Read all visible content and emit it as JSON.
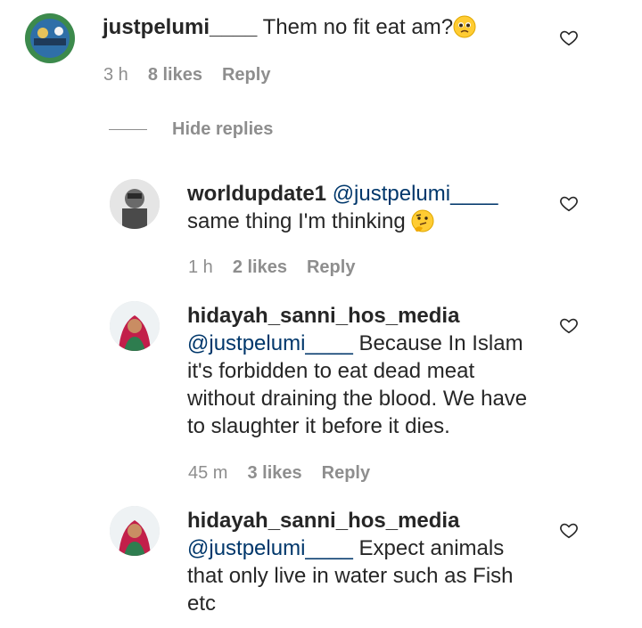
{
  "comments": [
    {
      "username": "justpelumi____",
      "mention": "",
      "text": "Them no fit eat am?",
      "time": "3 h",
      "likes": "8 likes",
      "reply": "Reply"
    },
    {
      "username": "worldupdate1",
      "mention": "@justpelumi____",
      "text": "same thing I'm thinking",
      "time": "1 h",
      "likes": "2 likes",
      "reply": "Reply"
    },
    {
      "username": "hidayah_sanni_hos_media",
      "mention": "@justpelumi____",
      "text_line1": "Because In Islam",
      "text_line2": "it's forbidden to eat dead meat",
      "text_line3": "without draining the blood. We have",
      "text_line4": "to slaughter it before it dies.",
      "time": "45 m",
      "likes": "3 likes",
      "reply": "Reply"
    },
    {
      "username": "hidayah_sanni_hos_media",
      "mention": "@justpelumi____",
      "text_line1": "Expect animals",
      "text_line2": "that only live in water such as Fish",
      "text_line3": "etc"
    }
  ],
  "hide_replies": "Hide replies",
  "icons": {
    "heart": "heart-outline-icon",
    "emoji1": "pleading-face-emoji",
    "emoji2": "thinking-face-emoji"
  },
  "colors": {
    "text": "#262626",
    "meta": "#8e8e8e",
    "mention": "#00376b"
  }
}
